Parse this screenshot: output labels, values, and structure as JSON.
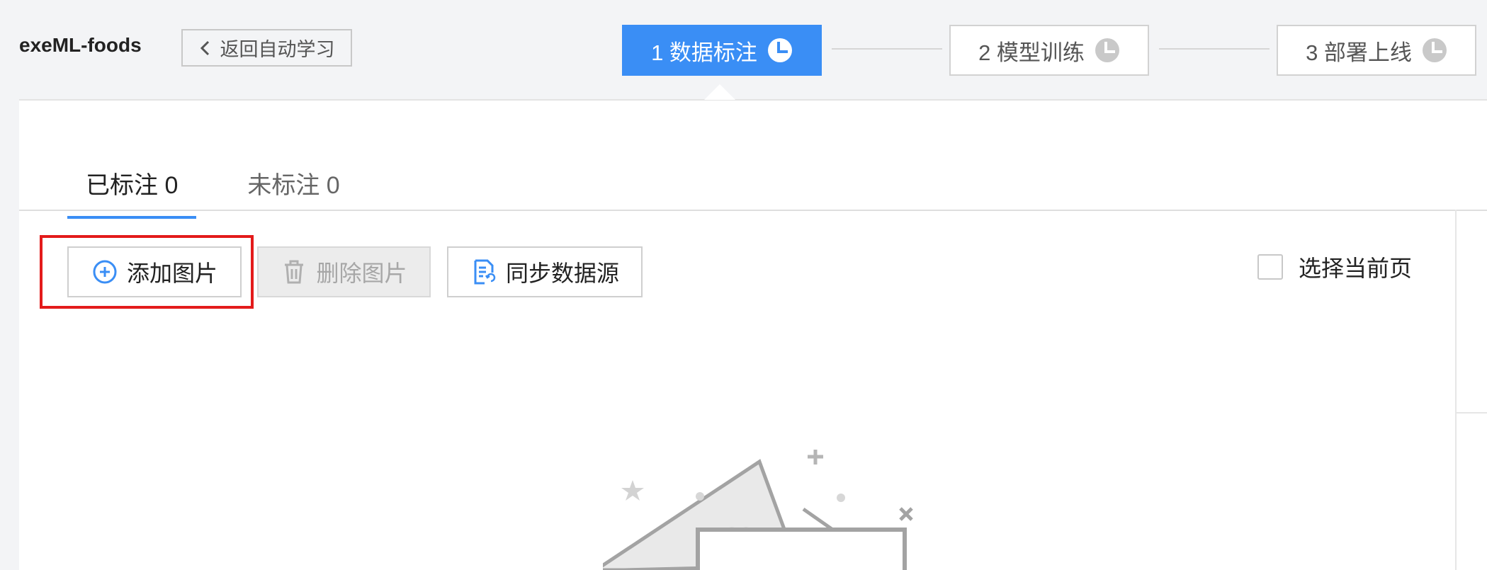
{
  "header": {
    "app_name": "exeML-foods",
    "back_label": "返回自动学习",
    "steps": [
      {
        "label": "1 数据标注",
        "active": true
      },
      {
        "label": "2 模型训练",
        "active": false
      },
      {
        "label": "3 部署上线",
        "active": false
      }
    ]
  },
  "tabs": [
    {
      "label": "已标注 0",
      "active": true
    },
    {
      "label": "未标注 0",
      "active": false
    }
  ],
  "toolbar": {
    "add_label": "添加图片",
    "delete_label": "删除图片",
    "sync_label": "同步数据源",
    "select_page_label": "选择当前页"
  },
  "colors": {
    "accent": "#3a8ef5",
    "highlight": "#e31b1b"
  },
  "icons": {
    "back": "chevron-left-icon",
    "step_status": "clock-icon",
    "add": "plus-circle-icon",
    "delete": "trash-icon",
    "sync": "document-sync-icon",
    "empty_state": "empty-image-illustration"
  }
}
